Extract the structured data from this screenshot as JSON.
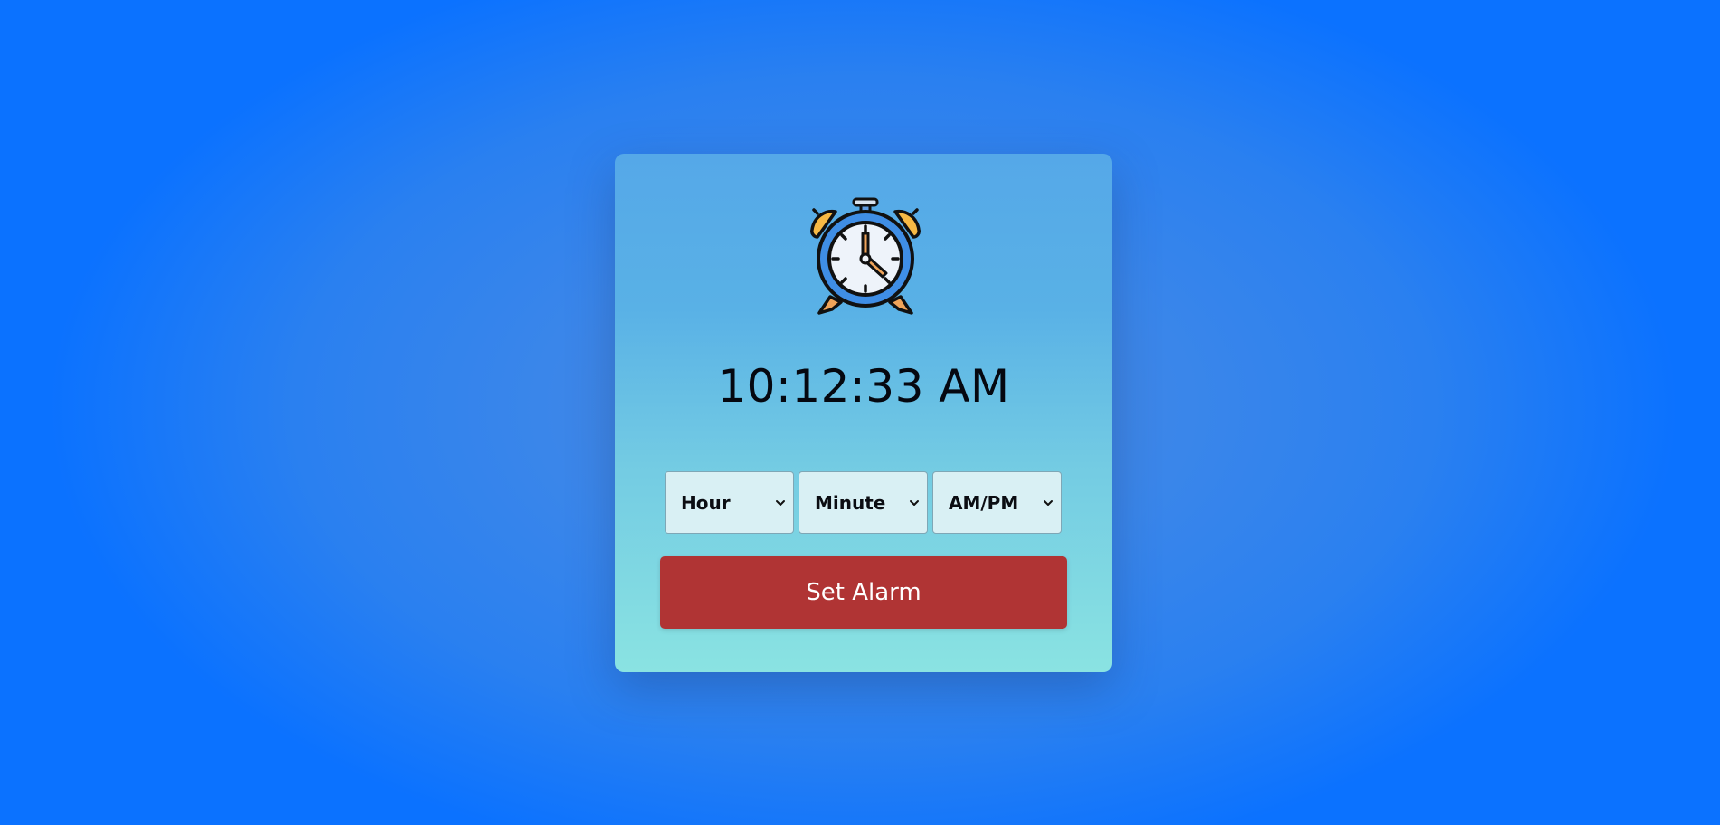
{
  "clock": {
    "icon": "alarm-clock-icon",
    "time": "10:12:33 AM"
  },
  "alarm_form": {
    "hour": {
      "selected": "Hour",
      "icon": "chevron-down-icon"
    },
    "minute": {
      "selected": "Minute",
      "icon": "chevron-down-icon"
    },
    "ampm": {
      "selected": "AM/PM",
      "icon": "chevron-down-icon"
    },
    "submit_label": "Set Alarm"
  },
  "colors": {
    "page_background": "#0b72ff",
    "card_top": "#55a8e8",
    "card_bottom": "#8ae3e2",
    "button": "#b03434",
    "select_background": "#d9f0f4"
  }
}
